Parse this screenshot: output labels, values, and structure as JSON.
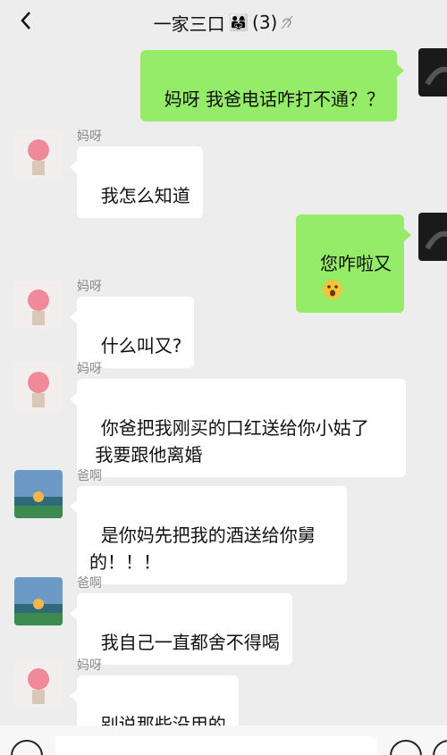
{
  "header": {
    "title": "一家三口",
    "title_emoji": "👨‍👩‍👧",
    "member_count": "(3)",
    "back_icon": "chevron-left-icon",
    "mute_icon": "ear-icon"
  },
  "messages": [
    {
      "side": "right",
      "sender": "",
      "text": "妈呀 我爸电话咋打不通？？"
    },
    {
      "side": "left",
      "sender": "妈呀",
      "text": "我怎么知道"
    },
    {
      "side": "right",
      "sender": "",
      "text": "您咋啦又"
    },
    {
      "side": "left",
      "sender": "妈呀",
      "text": "什么叫又?"
    },
    {
      "side": "left",
      "sender": "妈呀",
      "text": "你爸把我刚买的口红送给你小姑了\n 我要跟他离婚"
    },
    {
      "side": "left",
      "sender": "爸啊",
      "text": "是你妈先把我的酒送给你舅\n的！！！"
    },
    {
      "side": "left",
      "sender": "爸啊",
      "text": "我自己一直都舍不得喝"
    },
    {
      "side": "left",
      "sender": "妈呀",
      "text": "别说那些没用的"
    }
  ],
  "colors": {
    "background": "#ededed",
    "right_bubble": "#95ec69",
    "left_bubble": "#ffffff",
    "name": "#8a8a8a"
  }
}
